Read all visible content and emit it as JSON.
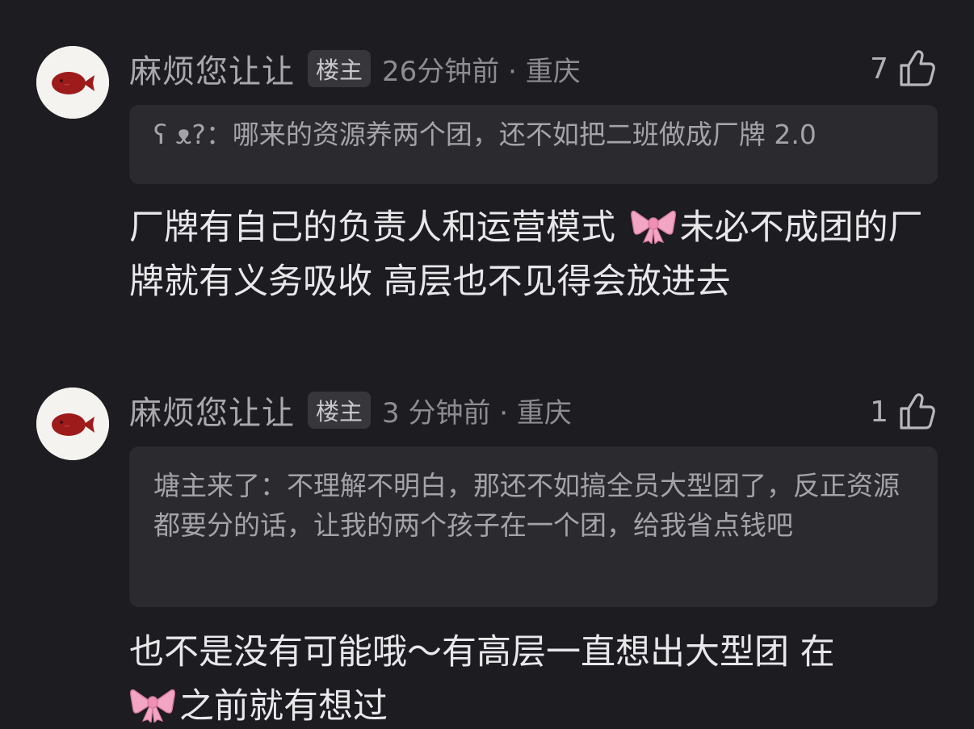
{
  "comments": [
    {
      "username": "麻烦您让让",
      "badge": "楼主",
      "meta": "26分钟前 · 重庆",
      "likes": "7",
      "quote": "ʕ ᴥ?：哪来的资源养两个团，还不如把二班做成厂牌 2.0",
      "body_before": "厂牌有自己的负责人和运营模式 ",
      "body_after": "未必不成团的厂牌就有义务吸收 高层也不见得会放进去"
    },
    {
      "username": "麻烦您让让",
      "badge": "楼主",
      "meta": "3 分钟前 · 重庆",
      "likes": "1",
      "quote": "塘主来了：不理解不明白，那还不如搞全员大型团了，反正资源都要分的话，让我的两个孩子在一个团，给我省点钱吧",
      "body_before": "也不是没有可能哦～有高层一直想出大型团 在",
      "body_after": "之前就有想过"
    }
  ],
  "icons": {
    "avatar": "fish-avatar-icon",
    "like": "thumbs-up-icon",
    "emoji": "pink-bow-emoji"
  },
  "colors": {
    "background": "#1d1c21",
    "quote_bg": "#2a2a2f",
    "fish": "#9e1b1b",
    "bow": "#f3a6c3"
  }
}
